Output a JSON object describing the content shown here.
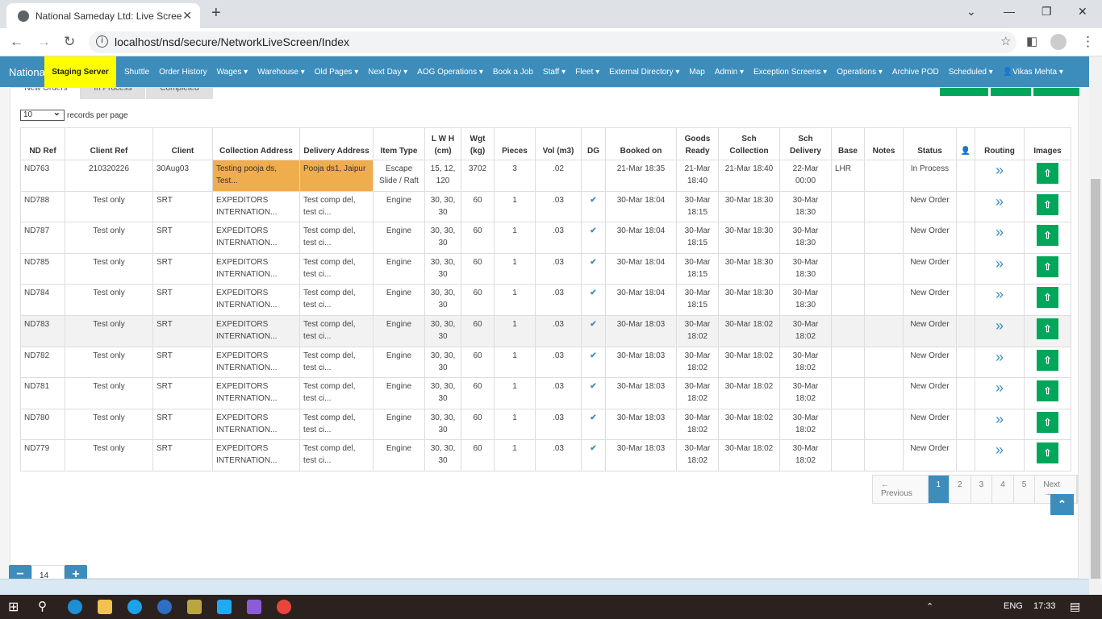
{
  "browser": {
    "tab_title": "National Sameday Ltd: Live Scree",
    "url": "localhost/nsd/secure/NetworkLiveScreen/Index"
  },
  "navbar": {
    "brand": "Nationa",
    "staging": "Staging Server",
    "items": [
      "Shuttle",
      "Order History",
      "Wages ▾",
      "Warehouse ▾",
      "Old Pages ▾",
      "Next Day ▾",
      "AOG Operations ▾",
      "Book a Job",
      "Staff ▾",
      "Fleet ▾",
      "External Directory ▾",
      "Map",
      "Admin ▾",
      "Exception Screens ▾",
      "Operations ▾",
      "Archive POD",
      "Scheduled ▾",
      "👤Vikas Mehta ▾"
    ]
  },
  "tabs": [
    "New Orders",
    "In Process",
    "Completed"
  ],
  "records": {
    "value": "10",
    "label": "records per page"
  },
  "columns": [
    "ND Ref",
    "Client Ref",
    "Client",
    "Collection Address",
    "Delivery Address",
    "Item Type",
    "L W H (cm)",
    "Wgt (kg)",
    "Pieces",
    "Vol (m3)",
    "DG",
    "Booked on",
    "Goods Ready",
    "Sch Collection",
    "Sch Delivery",
    "Base",
    "Notes",
    "Status",
    "",
    "Routing",
    "Images"
  ],
  "rows": [
    [
      "ND763",
      "210320226",
      "30Aug03",
      "Testing pooja ds, Test...",
      "Pooja ds1, Jaipur",
      "Escape Slide / Raft",
      "15, 12, 120",
      "3702",
      "3",
      ".02",
      "",
      "21-Mar 18:35",
      "21-Mar 18:40",
      "21-Mar 18:40",
      "22-Mar 00:00",
      "LHR",
      "",
      "In Process"
    ],
    [
      "ND788",
      "Test only",
      "SRT",
      "EXPEDITORS INTERNATION...",
      "Test comp del, test ci...",
      "Engine",
      "30, 30, 30",
      "60",
      "1",
      ".03",
      "✔",
      "30-Mar 18:04",
      "30-Mar 18:15",
      "30-Mar 18:30",
      "30-Mar 18:30",
      "",
      "",
      "New Order"
    ],
    [
      "ND787",
      "Test only",
      "SRT",
      "EXPEDITORS INTERNATION...",
      "Test comp del, test ci...",
      "Engine",
      "30, 30, 30",
      "60",
      "1",
      ".03",
      "✔",
      "30-Mar 18:04",
      "30-Mar 18:15",
      "30-Mar 18:30",
      "30-Mar 18:30",
      "",
      "",
      "New Order"
    ],
    [
      "ND785",
      "Test only",
      "SRT",
      "EXPEDITORS INTERNATION...",
      "Test comp del, test ci...",
      "Engine",
      "30, 30, 30",
      "60",
      "1",
      ".03",
      "✔",
      "30-Mar 18:04",
      "30-Mar 18:15",
      "30-Mar 18:30",
      "30-Mar 18:30",
      "",
      "",
      "New Order"
    ],
    [
      "ND784",
      "Test only",
      "SRT",
      "EXPEDITORS INTERNATION...",
      "Test comp del, test ci...",
      "Engine",
      "30, 30, 30",
      "60",
      "1",
      ".03",
      "✔",
      "30-Mar 18:04",
      "30-Mar 18:15",
      "30-Mar 18:30",
      "30-Mar 18:30",
      "",
      "",
      "New Order"
    ],
    [
      "ND783",
      "Test only",
      "SRT",
      "EXPEDITORS INTERNATION...",
      "Test comp del, test ci...",
      "Engine",
      "30, 30, 30",
      "60",
      "1",
      ".03",
      "✔",
      "30-Mar 18:03",
      "30-Mar 18:02",
      "30-Mar 18:02",
      "30-Mar 18:02",
      "",
      "",
      "New Order"
    ],
    [
      "ND782",
      "Test only",
      "SRT",
      "EXPEDITORS INTERNATION...",
      "Test comp del, test ci...",
      "Engine",
      "30, 30, 30",
      "60",
      "1",
      ".03",
      "✔",
      "30-Mar 18:03",
      "30-Mar 18:02",
      "30-Mar 18:02",
      "30-Mar 18:02",
      "",
      "",
      "New Order"
    ],
    [
      "ND781",
      "Test only",
      "SRT",
      "EXPEDITORS INTERNATION...",
      "Test comp del, test ci...",
      "Engine",
      "30, 30, 30",
      "60",
      "1",
      ".03",
      "✔",
      "30-Mar 18:03",
      "30-Mar 18:02",
      "30-Mar 18:02",
      "30-Mar 18:02",
      "",
      "",
      "New Order"
    ],
    [
      "ND780",
      "Test only",
      "SRT",
      "EXPEDITORS INTERNATION...",
      "Test comp del, test ci...",
      "Engine",
      "30, 30, 30",
      "60",
      "1",
      ".03",
      "✔",
      "30-Mar 18:03",
      "30-Mar 18:02",
      "30-Mar 18:02",
      "30-Mar 18:02",
      "",
      "",
      "New Order"
    ],
    [
      "ND779",
      "Test only",
      "SRT",
      "EXPEDITORS INTERNATION...",
      "Test comp del, test ci...",
      "Engine",
      "30, 30, 30",
      "60",
      "1",
      ".03",
      "✔",
      "30-Mar 18:03",
      "30-Mar 18:02",
      "30-Mar 18:02",
      "30-Mar 18:02",
      "",
      "",
      "New Order"
    ]
  ],
  "pagination": {
    "prev": "← Previous",
    "pages": [
      "1",
      "2",
      "3",
      "4",
      "5"
    ],
    "active": "1",
    "next": "Next →"
  },
  "zoom": {
    "value": "14"
  },
  "taskbar": {
    "lang": "ENG",
    "time": "17:33"
  },
  "colors": {
    "primary": "#3c8dbc",
    "success": "#00a65a",
    "highlight": "#f0ad4e",
    "staging": "#ffff00"
  }
}
